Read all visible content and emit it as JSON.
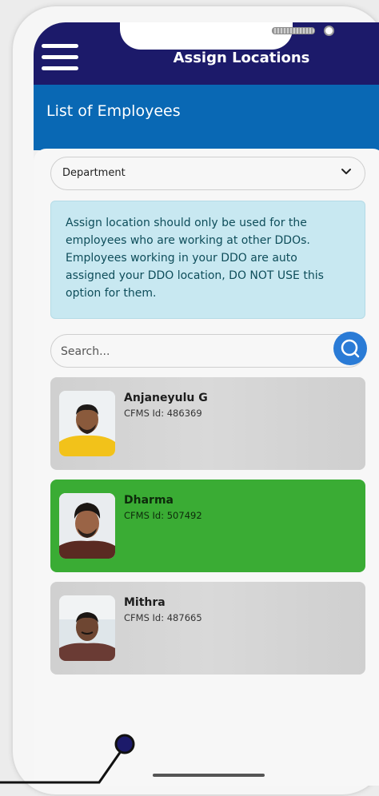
{
  "header": {
    "title": "Assign Locations",
    "menu_icon": "hamburger-menu-icon"
  },
  "subheader": {
    "title": "List of Employees"
  },
  "filter": {
    "selected": "Department"
  },
  "notice": {
    "text": "Assign location should only be used for the employees who are working at other DDOs. Employees working in your DDO are auto assigned your DDO location, DO NOT USE this option for them."
  },
  "search": {
    "placeholder": "Search..."
  },
  "employees": [
    {
      "name": "Anjaneyulu G",
      "cfms": "CFMS Id: 486369",
      "selected": false
    },
    {
      "name": "Dharma",
      "cfms": "CFMS Id: 507492",
      "selected": true
    },
    {
      "name": "Mithra",
      "cfms": "CFMS Id: 487665",
      "selected": false
    }
  ],
  "colors": {
    "topbar": "#1c1a6a",
    "subbar": "#0968b4",
    "selected_card": "#3aac34",
    "notice_bg": "#c8e8f1",
    "search_button": "#2a7bd6"
  }
}
